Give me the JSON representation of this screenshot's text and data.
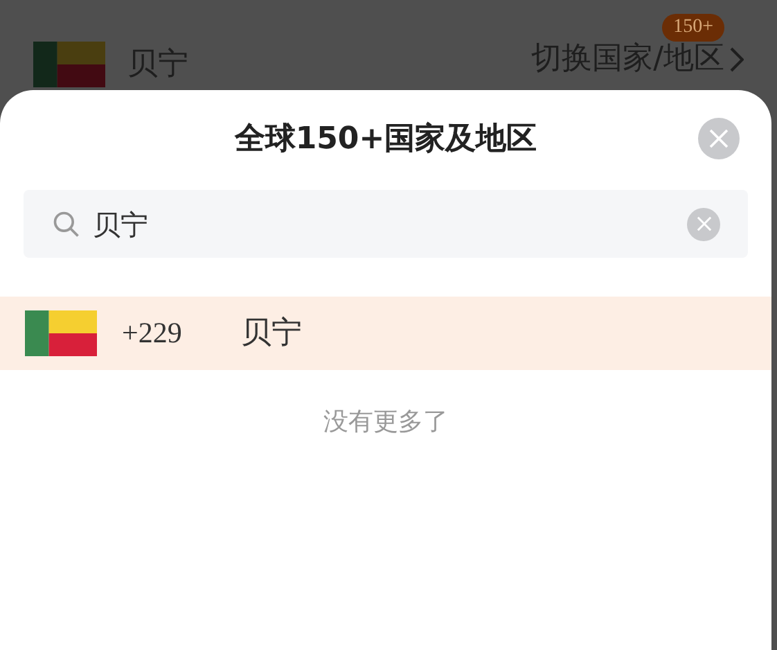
{
  "page": {
    "country": "贝宁",
    "switch_link": "切换国家/地区",
    "badge": "150+"
  },
  "sheet": {
    "title": "全球150+国家及地区",
    "search": {
      "value": "贝宁"
    },
    "results": [
      {
        "code": "+229",
        "name": "贝宁",
        "selected": true
      }
    ],
    "footer": "没有更多了"
  }
}
